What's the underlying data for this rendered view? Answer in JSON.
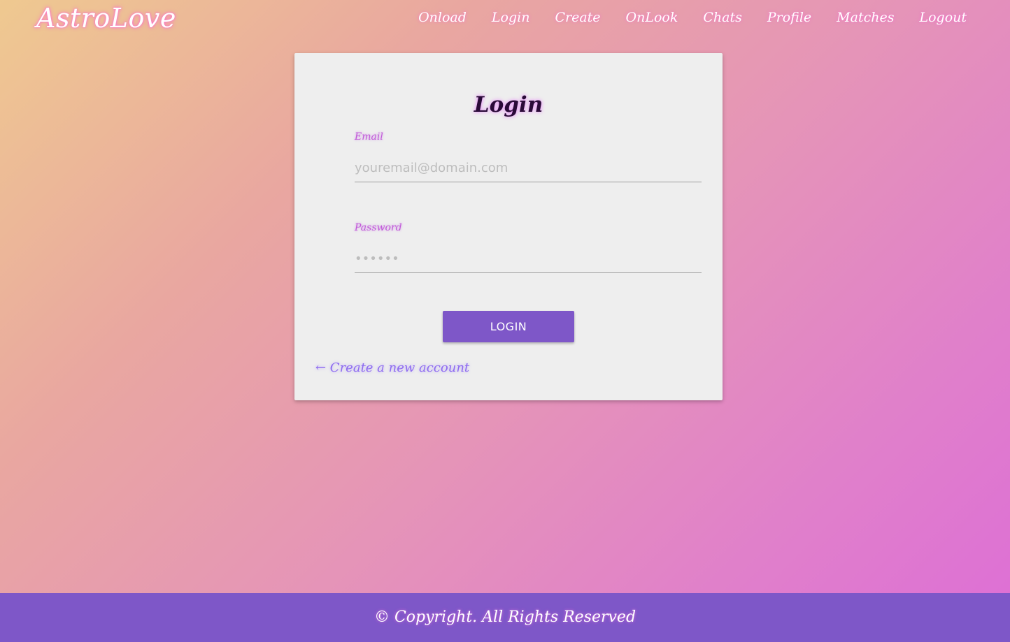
{
  "navbar": {
    "brand": "AstroLove",
    "links": [
      {
        "label": "Onload"
      },
      {
        "label": "Login"
      },
      {
        "label": "Create"
      },
      {
        "label": "OnLook"
      },
      {
        "label": "Chats"
      },
      {
        "label": "Profile"
      },
      {
        "label": "Matches"
      },
      {
        "label": "Logout"
      }
    ]
  },
  "login_form": {
    "title": "Login",
    "email": {
      "label": "Email",
      "value": "",
      "placeholder": "youremail@domain.com"
    },
    "password": {
      "label": "Password",
      "value": "",
      "placeholder": "••••••"
    },
    "submit_label": "LOGIN",
    "create_account_link": "← Create a new account"
  },
  "footer": {
    "text": "© Copyright. All Rights Reserved"
  },
  "colors": {
    "accent": "#7e57c8",
    "card_background": "#eeeeee",
    "label_color": "#c25ad8",
    "link_color": "#8e6bf0",
    "gradient_start": "#efc990",
    "gradient_end": "#dd6ed6"
  }
}
